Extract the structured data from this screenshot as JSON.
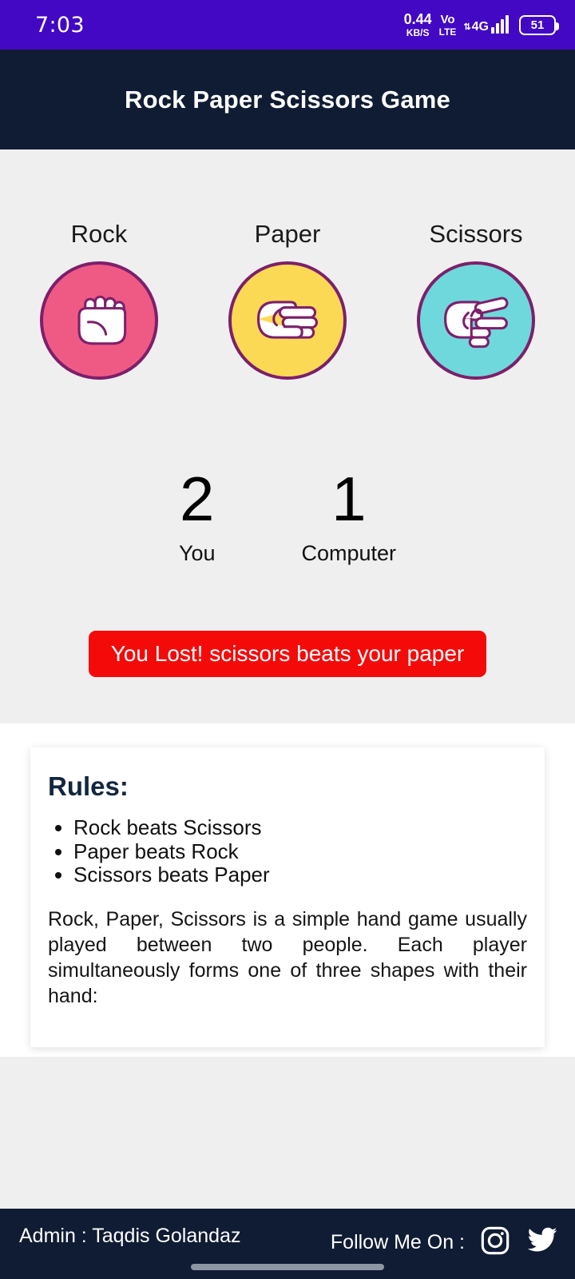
{
  "statusbar": {
    "clock": "7:03",
    "net_speed_value": "0.44",
    "net_speed_unit": "KB/S",
    "volte_top": "Vo",
    "volte_bottom": "LTE",
    "network_type": "4G",
    "data_arrows": "⇅",
    "battery_level": "51",
    "background_color": "#4208c4"
  },
  "header": {
    "title": "Rock Paper Scissors Game",
    "background_color": "#101c33"
  },
  "game": {
    "background_color": "#efefef",
    "choices": [
      {
        "label": "Rock",
        "icon": "fist-hand-icon",
        "fill": "#ef5a85",
        "stroke": "#7d1f6b"
      },
      {
        "label": "Paper",
        "icon": "flat-hand-icon",
        "fill": "#fcd954",
        "stroke": "#7d1f6b"
      },
      {
        "label": "Scissors",
        "icon": "two-finger-hand-icon",
        "fill": "#6fd8dc",
        "stroke": "#7d1f6b"
      }
    ],
    "scores": [
      {
        "value": "2",
        "label": "You"
      },
      {
        "value": "1",
        "label": "Computer"
      }
    ],
    "result": {
      "text": "You Lost! scissors beats your paper",
      "background_color": "#f50a0a",
      "text_color": "#ffffff"
    }
  },
  "rules": {
    "title": "Rules:",
    "items": [
      "Rock beats Scissors",
      "Paper beats Rock",
      "Scissors beats Paper"
    ],
    "paragraph": "Rock, Paper, Scissors is a simple hand game usually played between two people. Each player simultaneously forms one of three shapes with their hand:"
  },
  "footer": {
    "admin_text": "Admin :  Taqdis Golandaz",
    "follow_text": "Follow Me On :",
    "social": [
      {
        "name": "instagram-icon"
      },
      {
        "name": "twitter-icon"
      }
    ],
    "background_color": "#101c33"
  }
}
